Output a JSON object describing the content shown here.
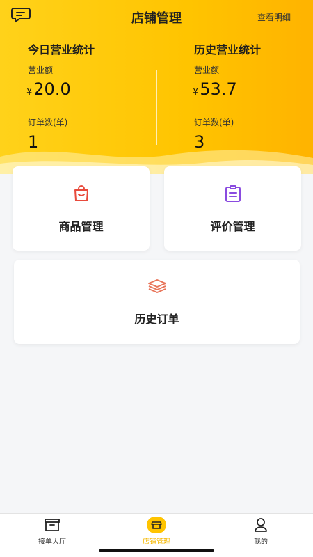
{
  "header": {
    "title": "店铺管理",
    "detail_link": "查看明细"
  },
  "today_stats": {
    "title": "今日营业统计",
    "revenue_label": "营业额",
    "currency": "¥",
    "revenue_value": "20.0",
    "orders_label": "订单数(单)",
    "orders_value": "1"
  },
  "history_stats": {
    "title": "历史营业统计",
    "revenue_label": "营业额",
    "currency": "¥",
    "revenue_value": "53.7",
    "orders_label": "订单数(单)",
    "orders_value": "3"
  },
  "cards": {
    "products": "商品管理",
    "reviews": "评价管理",
    "history_orders": "历史订单"
  },
  "tabbar": {
    "items": [
      {
        "label": "接单大厅",
        "icon": "inbox-icon",
        "active": false
      },
      {
        "label": "店铺管理",
        "icon": "store-icon",
        "active": true
      },
      {
        "label": "我的",
        "icon": "user-icon",
        "active": false
      }
    ]
  },
  "colors": {
    "accent": "#ffc400",
    "products_icon": "#e84a3c",
    "reviews_icon": "#8a4be0",
    "history_icon": "#e8755a",
    "tab_active": "#f5b800"
  }
}
